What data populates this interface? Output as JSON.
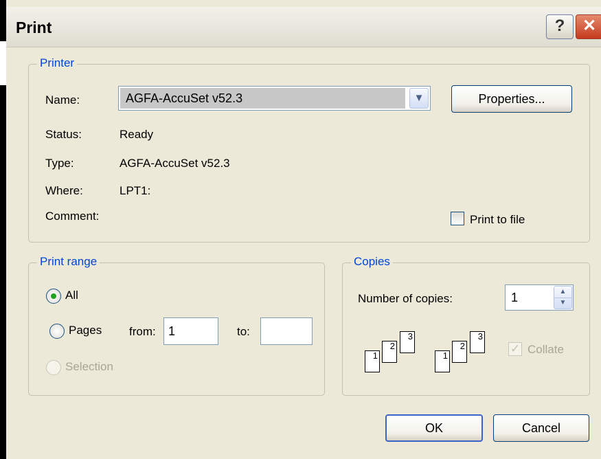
{
  "window": {
    "title": "Print",
    "help_glyph": "?",
    "close_glyph": "✕"
  },
  "printer": {
    "legend": "Printer",
    "name_label": "Name:",
    "name_value": "AGFA-AccuSet v52.3",
    "properties_label": "Properties...",
    "status_label": "Status:",
    "status_value": "Ready",
    "type_label": "Type:",
    "type_value": "AGFA-AccuSet v52.3",
    "where_label": "Where:",
    "where_value": "LPT1:",
    "comment_label": "Comment:",
    "print_to_file_label": "Print to file",
    "print_to_file_checked": false
  },
  "print_range": {
    "legend": "Print range",
    "all_label": "All",
    "pages_label": "Pages",
    "from_label": "from:",
    "from_value": "1",
    "to_label": "to:",
    "to_value": "",
    "selection_label": "Selection",
    "selected": "All"
  },
  "copies": {
    "legend": "Copies",
    "number_label": "Number of copies:",
    "number_value": "1",
    "collate_label": "Collate",
    "collate_checked": true,
    "collate_enabled": false,
    "page_numbers": [
      "1",
      "2",
      "3"
    ]
  },
  "buttons": {
    "ok": "OK",
    "cancel": "Cancel"
  },
  "icons": {
    "dropdown": "chevron-down-icon",
    "spin_up": "arrow-up-icon",
    "spin_down": "arrow-down-icon",
    "checkmark": "checkmark-icon"
  },
  "colors": {
    "dialog_background": "#ece9d8",
    "legend_text": "#0046d5",
    "close_button": "#c53a1c",
    "selected_radio": "#21a121"
  }
}
